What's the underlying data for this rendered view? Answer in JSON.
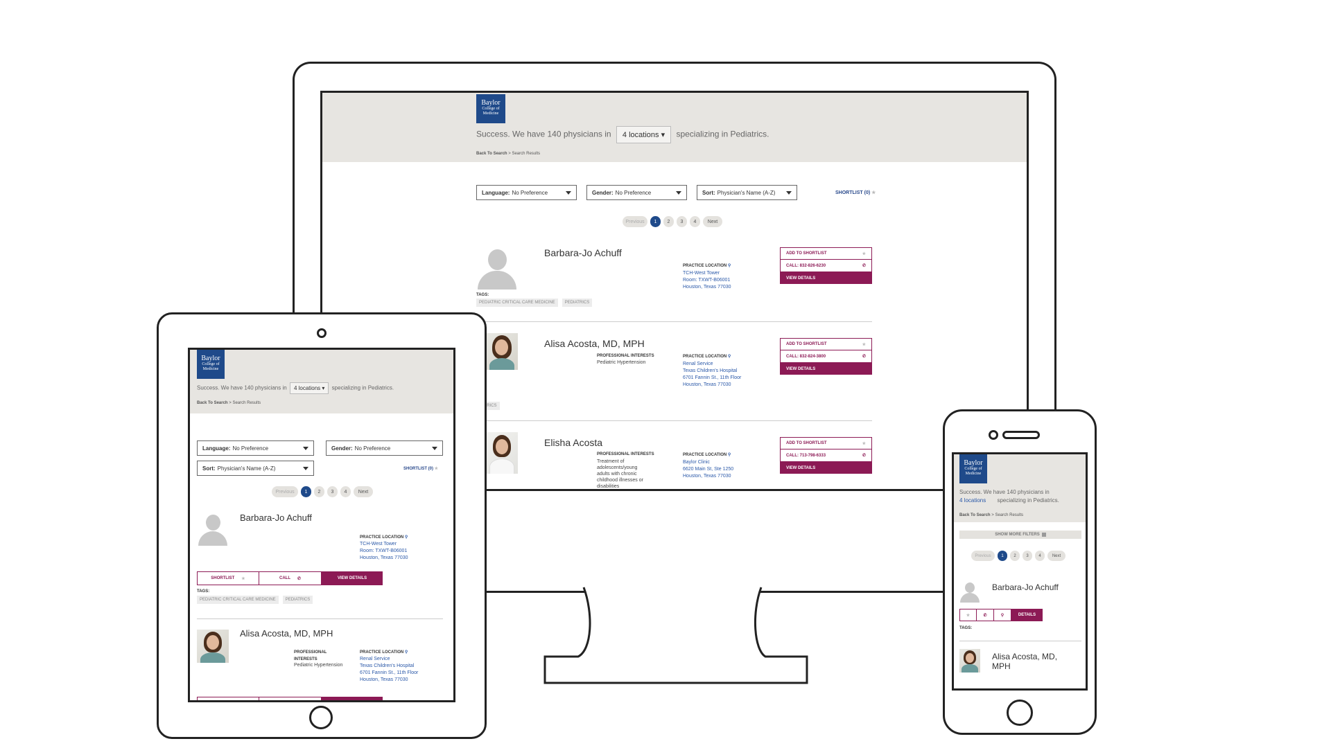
{
  "logo": {
    "line1": "Baylor",
    "line2": "College of",
    "line3": "Medicine"
  },
  "header": {
    "success_pre": "Success. We have 140 physicians in",
    "locations_label": "4 locations",
    "success_post": "specializing in Pediatrics.",
    "crumb_back": "Back To Search",
    "crumb_sep": ">",
    "crumb_current": "Search Results"
  },
  "filters": {
    "language_key": "Language:",
    "language_val": "No Preference",
    "gender_key": "Gender:",
    "gender_val": "No Preference",
    "sort_key": "Sort:",
    "sort_val": "Physician's Name (A-Z)",
    "shortlist": "SHORTLIST (0)",
    "show_more": "SHOW MORE FILTERS"
  },
  "pagination": {
    "prev": "Previous",
    "pages": [
      "1",
      "2",
      "3",
      "4"
    ],
    "next": "Next"
  },
  "labels": {
    "practice_location": "PRACTICE LOCATION",
    "professional_interests": "PROFESSIONAL INTERESTS",
    "tags": "TAGS:",
    "add_shortlist": "ADD TO SHORTLIST",
    "view_details": "VIEW DETAILS",
    "shortlist": "SHORTLIST",
    "call": "CALL",
    "details": "DETAILS"
  },
  "physicians": [
    {
      "name": "Barbara-Jo Achuff",
      "call": "CALL: 832-826-6230",
      "location": [
        "TCH-West Tower",
        "Room: TXWT-B06001",
        "Houston, Texas 77030"
      ],
      "tags": [
        "PEDIATRIC CRITICAL CARE MEDICINE",
        "PEDIATRICS"
      ]
    },
    {
      "name": "Alisa Acosta, MD, MPH",
      "call": "CALL: 832-824-3800",
      "interests": "Pediatric Hypertension",
      "location": [
        "Renal Service",
        "Texas Children's Hospital",
        "6701 Fannin St., 11th Floor",
        "Houston, Texas 77030"
      ],
      "tag_partial": "ATRICS"
    },
    {
      "name": "Elisha Acosta",
      "call": "CALL: 713-798-6333",
      "interests": "Treatment of adolescents/young adults with chronic childhood illnesses or disabilities",
      "location": [
        "Baylor Clinic",
        "6620 Main St, Ste 1250",
        "Houston, Texas 77030"
      ]
    }
  ],
  "phone": {
    "success_line1": "Success. We have 140 physicians in",
    "success_line2_pre": "4 locations",
    "success_line2_post": "specializing in Pediatrics.",
    "name2_line1": "Alisa Acosta, MD,",
    "name2_line2": "MPH"
  },
  "colors": {
    "brand_blue": "#1f4a8a",
    "accent": "#8c1a55",
    "header_bg": "#e7e5e1",
    "link": "#2a58a8"
  }
}
